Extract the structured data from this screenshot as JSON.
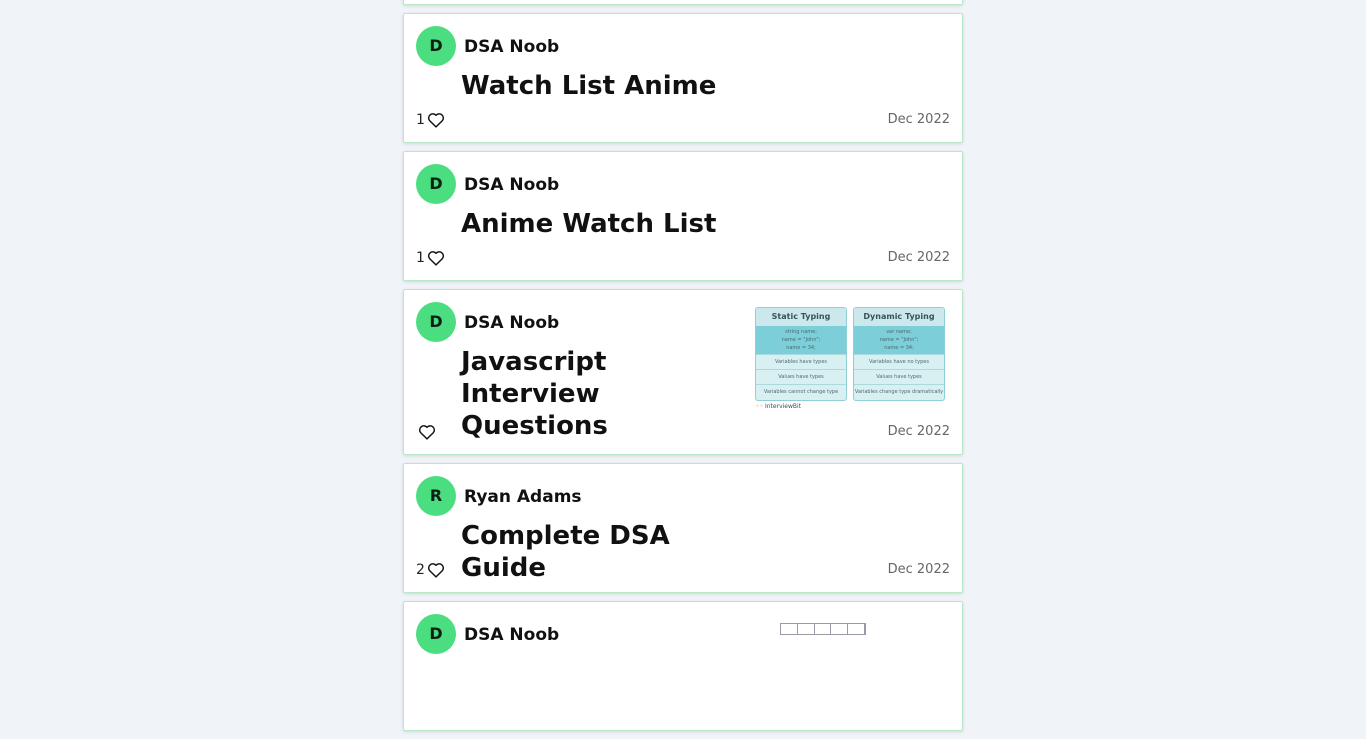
{
  "posts": [
    {
      "avatar_letter": "D",
      "author": "DSA Noob",
      "title": "Watch List Anime",
      "likes": "1",
      "date": "Dec 2022"
    },
    {
      "avatar_letter": "D",
      "author": "DSA Noob",
      "title": "Anime Watch List",
      "likes": "1",
      "date": "Dec 2022"
    },
    {
      "avatar_letter": "D",
      "author": "DSA Noob",
      "title": "Javascript Interview Questions",
      "likes": "",
      "date": "Dec 2022",
      "thumbnail": {
        "left_heading": "Static Typing",
        "left_code": [
          "string name;",
          "name = \"John\";",
          "name = 34;"
        ],
        "left_rows": [
          "Variables have types",
          "Values have types",
          "Variables cannot change type"
        ],
        "right_heading": "Dynamic Typing",
        "right_code": [
          "var name;",
          "name = \"John\";",
          "name = 34;"
        ],
        "right_rows": [
          "Variables have no types",
          "Values have types",
          "Variables change type dramatically"
        ],
        "brand": "InterviewBit"
      }
    },
    {
      "avatar_letter": "R",
      "author": "Ryan Adams",
      "title": "Complete DSA Guide",
      "likes": "2",
      "date": "Dec 2022"
    },
    {
      "avatar_letter": "D",
      "author": "DSA Noob"
    }
  ],
  "icons": {
    "like": "heart-icon"
  },
  "colors": {
    "avatar_bg": "#4ade80",
    "card_border": "#b9e8c8",
    "page_bg": "#f0f4f8"
  }
}
